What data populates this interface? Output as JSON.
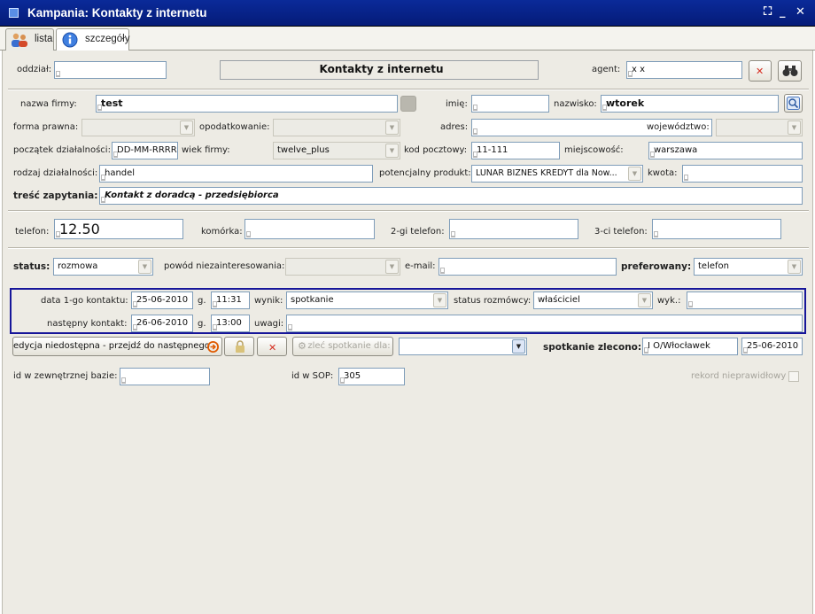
{
  "window": {
    "title": "Kampania: Kontakty z internetu",
    "controls": [
      "⛶",
      "_",
      "✕"
    ]
  },
  "tabs": [
    {
      "label": "lista",
      "icon": "users-icon"
    },
    {
      "label": "szczegóły",
      "icon": "info-icon"
    }
  ],
  "top": {
    "oddzial_label": "oddział:",
    "oddzial_value": "",
    "heading": "Kontakty z internetu",
    "agent_label": "agent:",
    "agent_value": "x x"
  },
  "firm": {
    "nazwa_label": "nazwa firmy:",
    "nazwa_value": "test",
    "imie_label": "imię:",
    "imie_value": "",
    "nazwisko_label": "nazwisko:",
    "nazwisko_value": "wtorek",
    "forma_label": "forma prawna:",
    "forma_value": "",
    "opodatk_label": "opodatkowanie:",
    "opodatk_value": "",
    "adres_label": "adres:",
    "adres_value": "",
    "woj_label": "województwo:",
    "woj_value": "",
    "poczatek_label": "początek działalności:",
    "poczatek_value": "DD-MM-RRRR",
    "wiek_label": "wiek firmy:",
    "wiek_value": "twelve_plus",
    "kod_label": "kod pocztowy:",
    "kod_value": "11-111",
    "miejsc_label": "miejscowość:",
    "miejsc_value": "warszawa",
    "rodzaj_label": "rodzaj działalności:",
    "rodzaj_value": "handel",
    "produkt_label": "potencjalny produkt:",
    "produkt_value": "LUNAR BIZNES KREDYT dla Now...",
    "kwota_label": "kwota:",
    "kwota_value": "",
    "tresc_label": "treść zapytania:",
    "tresc_value": "Kontakt z doradcą - przedsiębiorca"
  },
  "phones": {
    "telefon_label": "telefon:",
    "telefon_value": "12.50",
    "komorka_label": "komórka:",
    "komorka_value": "",
    "tel2_label": "2-gi telefon:",
    "tel2_value": "",
    "tel3_label": "3-ci telefon:",
    "tel3_value": ""
  },
  "status": {
    "status_label": "status:",
    "status_value": "rozmowa",
    "powod_label": "powód niezainteresowania:",
    "powod_value": "",
    "email_label": "e-mail:",
    "email_value": "",
    "pref_label": "preferowany:",
    "pref_value": "telefon"
  },
  "contact": {
    "data1_label": "data 1-go kontaktu:",
    "data1_value": "25-06-2010",
    "g_label": "g.",
    "godz1_value": "11:31",
    "wynik_label": "wynik:",
    "wynik_value": "spotkanie",
    "rozm_label": "status rozmówcy:",
    "rozm_value": "właściciel",
    "wyk_label": "wyk.:",
    "wyk_value": "",
    "next_label": "następny kontakt:",
    "next_value": "26-06-2010",
    "godz2_value": "13:00",
    "uwagi_label": "uwagi:",
    "uwagi_value": ""
  },
  "actions": {
    "edycja_label": "edycja niedostępna - przejdź do następnego",
    "zlec_label": "zleć spotkanie dla:",
    "zlec_value": "",
    "spotkanie_label": "spotkanie zlecono:",
    "spotkanie_value": "I O/Włocławek",
    "spotkanie_date": "25-06-2010"
  },
  "ids": {
    "ext_label": "id w zewnętrznej bazie:",
    "ext_value": "",
    "sop_label": "id w SOP:",
    "sop_value": "305",
    "rekord_label": "rekord nieprawidłowy"
  }
}
